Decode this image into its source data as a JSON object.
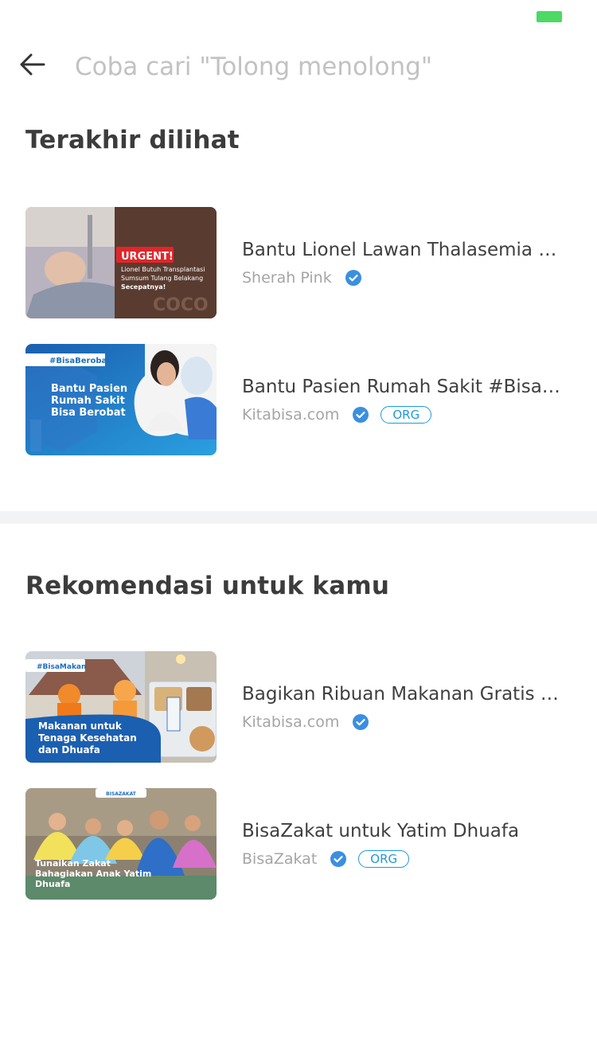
{
  "search": {
    "placeholder": "Coba cari \"Tolong menolong\""
  },
  "recent": {
    "title": "Terakhir dilihat",
    "items": [
      {
        "title": "Bantu Lionel Lawan Thalasemia Mayor",
        "author": "Sherah Pink",
        "verified": true,
        "org": "",
        "thumb": {
          "badge": "URGENT!",
          "line1": "Lionel Butuh Transplantasi",
          "line2": "Sumsum Tulang Belakang",
          "line3": "Secepatnya!"
        }
      },
      {
        "title": "Bantu Pasien Rumah Sakit #BisaBerobat",
        "author": "Kitabisa.com",
        "verified": true,
        "org": "ORG",
        "thumb": {
          "tag": "#BisaBerobat",
          "line1": "Bantu Pasien",
          "line2": "Rumah Sakit",
          "line3": "Bisa Berobat"
        }
      }
    ]
  },
  "recommend": {
    "title": "Rekomendasi untuk kamu",
    "items": [
      {
        "title": "Bagikan Ribuan Makanan Gratis untuk Nakes",
        "author": "Kitabisa.com",
        "verified": true,
        "org": "",
        "thumb": {
          "tag": "#BisaMakan",
          "line1": "Makanan untuk",
          "line2": "Tenaga Kesehatan",
          "line3": "dan Dhuafa"
        }
      },
      {
        "title": "BisaZakat untuk Yatim Dhuafa",
        "author": "BisaZakat",
        "verified": true,
        "org": "ORG",
        "thumb": {
          "tag": "BISAZAKAT",
          "line1": "Tunaikan Zakat",
          "line2": "Bahagiakan Anak Yatim",
          "line3": "Dhuafa"
        }
      }
    ]
  },
  "colors": {
    "verified": "#3b8fe0",
    "org": "#1e9ad6",
    "status_battery": "#4cd964"
  }
}
